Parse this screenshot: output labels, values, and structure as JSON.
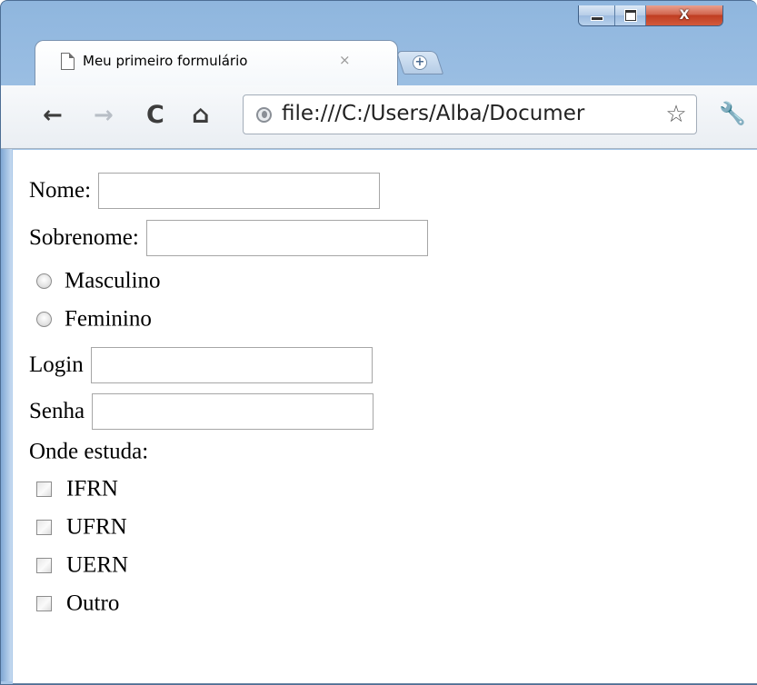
{
  "browser": {
    "tab": {
      "title": "Meu primeiro formulário",
      "close_glyph": "×"
    },
    "new_tab_glyph": "+",
    "window_controls": {
      "close_glyph": "X"
    },
    "toolbar": {
      "back_glyph": "←",
      "forward_glyph": "→",
      "reload_glyph": "C",
      "home_glyph": "⌂",
      "url": "file:///C:/Users/Alba/Documer",
      "star_glyph": "☆",
      "wrench_glyph": "🔧"
    },
    "icons": [
      "page-icon",
      "new-tab-icon",
      "minimize-icon",
      "maximize-icon",
      "close-icon",
      "back-icon",
      "forward-icon",
      "reload-icon",
      "home-icon",
      "globe-icon",
      "star-icon",
      "wrench-icon"
    ]
  },
  "form": {
    "nome_label": "Nome:",
    "sobrenome_label": "Sobrenome:",
    "sexo": [
      {
        "label": "Masculino",
        "checked": false
      },
      {
        "label": "Feminino",
        "checked": false
      }
    ],
    "login_label": "Login",
    "senha_label": "Senha",
    "onde_estuda_label": "Onde estuda:",
    "instituicoes": [
      {
        "label": "IFRN",
        "checked": false
      },
      {
        "label": "UFRN",
        "checked": false
      },
      {
        "label": "UERN",
        "checked": false
      },
      {
        "label": "Outro",
        "checked": false
      }
    ],
    "values": {
      "nome": "",
      "sobrenome": "",
      "login": "",
      "senha": ""
    }
  }
}
